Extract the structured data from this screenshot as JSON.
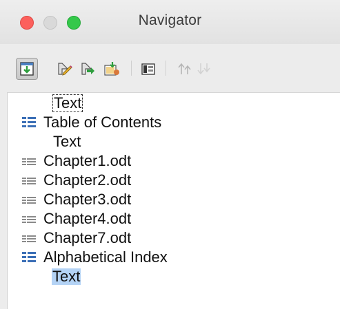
{
  "window": {
    "title": "Navigator"
  },
  "toolbar": {
    "buttons": [
      {
        "icon": "content-navigation-view-icon",
        "active": true
      },
      {
        "icon": "promote-chapter-icon"
      },
      {
        "icon": "demote-chapter-icon"
      },
      {
        "icon": "insert-icon"
      },
      {
        "icon": "save-contents-icon"
      },
      {
        "icon": "move-up-icon",
        "disabled": true
      },
      {
        "icon": "move-down-icon",
        "disabled": true
      }
    ]
  },
  "tree": {
    "items": [
      {
        "label": "Text",
        "type": "text",
        "focused": true
      },
      {
        "label": "Table of Contents",
        "type": "index"
      },
      {
        "label": "Text",
        "type": "text"
      },
      {
        "label": "Chapter1.odt",
        "type": "link"
      },
      {
        "label": "Chapter2.odt",
        "type": "link"
      },
      {
        "label": "Chapter3.odt",
        "type": "link"
      },
      {
        "label": "Chapter4.odt",
        "type": "link"
      },
      {
        "label": "Chapter7.odt",
        "type": "link"
      },
      {
        "label": "Alphabetical Index",
        "type": "index"
      },
      {
        "label": "Text",
        "type": "text",
        "selected": true
      }
    ]
  },
  "colors": {
    "close": "#fc605c",
    "minimize": "#d9d9d9",
    "maximize": "#34c84a",
    "selection": "#b4d3f5",
    "index_icon": "#3b6fb6"
  }
}
